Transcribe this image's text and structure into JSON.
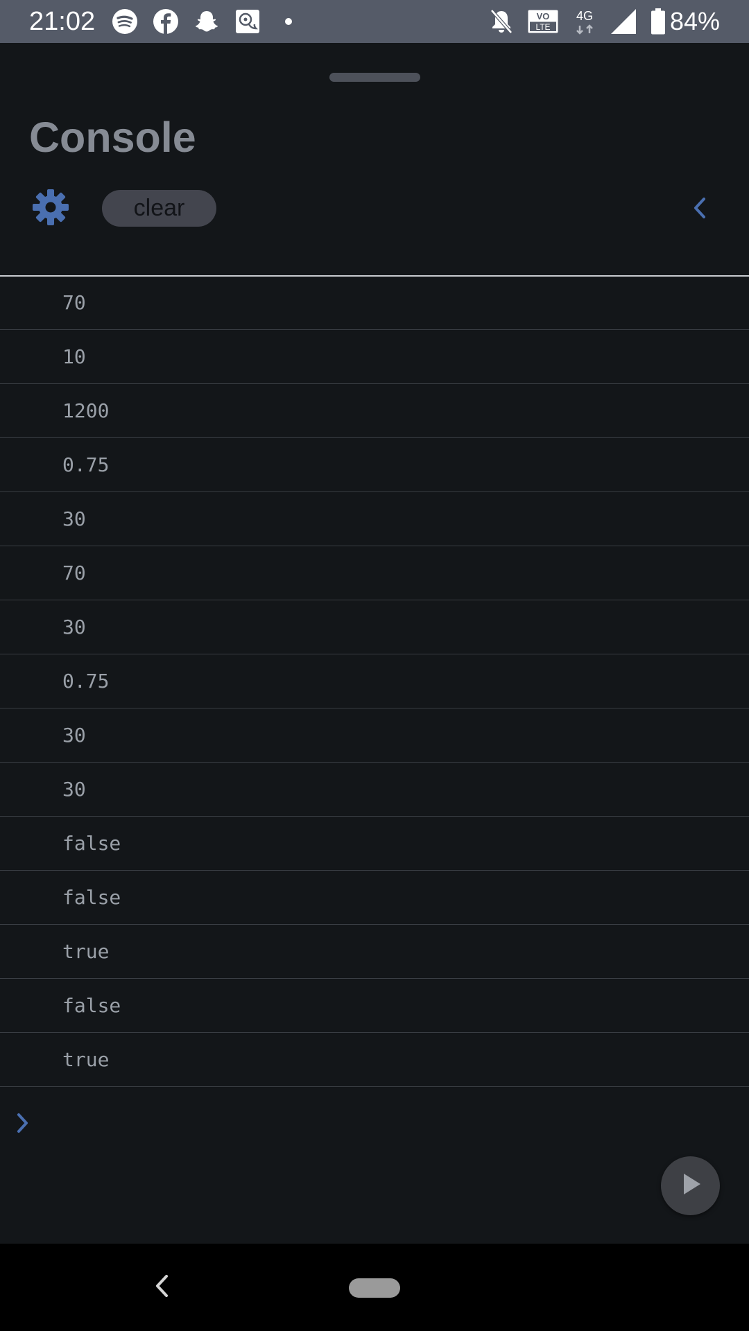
{
  "status_bar": {
    "time": "21:02",
    "left_icons": [
      "spotify-icon",
      "facebook-icon",
      "snapchat-icon",
      "chat-app-icon",
      "dot-icon"
    ],
    "right_icons": [
      "bell-off-icon",
      "volte-icon",
      "4g-icon",
      "signal-icon",
      "battery-icon"
    ],
    "volte_label_top": "VO",
    "volte_label_bottom": "LTE",
    "network_label": "4G",
    "battery_percent": "84%"
  },
  "header": {
    "title": "Console",
    "settings_icon": "gear-icon",
    "clear_label": "clear",
    "collapse_icon": "chevron-left-icon"
  },
  "console": {
    "entries": [
      "70",
      "10",
      "1200",
      "0.75",
      "30",
      "70",
      "30",
      "0.75",
      "30",
      "30",
      "false",
      "false",
      "true",
      "false",
      "true"
    ],
    "prompt_icon": "chevron-right-icon",
    "run_icon": "play-icon"
  },
  "colors": {
    "accent": "#4a6fb0",
    "background": "#131619",
    "status_bar": "#555b68",
    "text_muted": "#9aa0a8"
  },
  "nav_bar": {
    "icons": [
      "back-icon",
      "home-pill-icon"
    ]
  }
}
